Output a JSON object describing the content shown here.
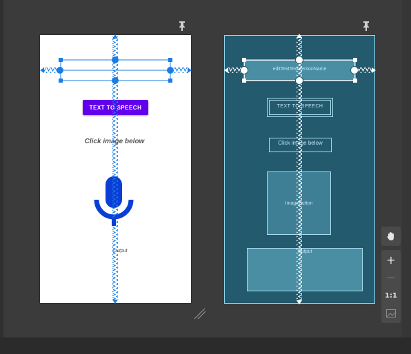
{
  "design": {
    "tts_button_label": "TEXT TO SPEECH",
    "click_label": "Click image below",
    "output_label": "Output"
  },
  "blueprint": {
    "edittext_id": "editTextTextPersonName",
    "tts_button_label": "TEXT TO SPEECH",
    "click_label": "Click image below",
    "image_button_label": "ImageButton",
    "output_label": "Output"
  },
  "toolbar": {
    "pan_icon": "hand-icon",
    "zoom_in_label": "+",
    "zoom_out_label": "—",
    "actual_size_label": "1:1",
    "fit_screen_icon": "fit-screen-icon"
  },
  "colors": {
    "constraint_blue": "#1a7de6",
    "button_purple": "#6200ee",
    "blueprint_bg": "#245a6e",
    "blueprint_line": "#a9dcef",
    "mic_blue": "#0a3fd6"
  }
}
